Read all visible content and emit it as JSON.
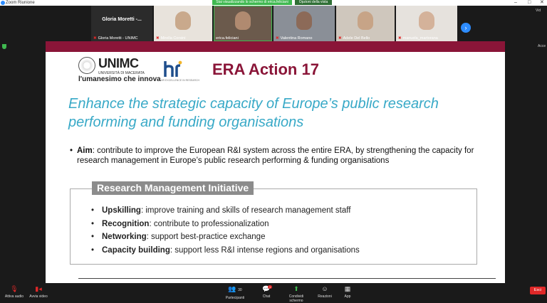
{
  "window": {
    "title": "Zoom Riunione",
    "controls": [
      "–",
      "□",
      "✕"
    ]
  },
  "share_banner": {
    "label": "Stai visualizzando lo schermo di erica.feliciani",
    "view_options": "Opzioni della vista"
  },
  "participants_strip": {
    "big_tile": {
      "display_name": "Gloria Moretti -...",
      "label": "Gloria Moretti - UNIMC"
    },
    "tiles": [
      {
        "label": "Mirella Corsini",
        "face_color": "#c9a98c"
      },
      {
        "label": "erica.feliciani",
        "face_color": "#b08a70"
      },
      {
        "label": "Valentina Romano",
        "face_color": "#8c6a58"
      },
      {
        "label": "Adele Del Bello",
        "face_color": "#c7a487"
      },
      {
        "label": "manuela_martorana",
        "face_color": "#d4b29a"
      }
    ],
    "next_icon": "chevron-right-icon",
    "right_label": "Vid",
    "right_label2": "Acce"
  },
  "slide": {
    "accent_color": "#8a1538",
    "logo": {
      "wordmark": "UNIMC",
      "subtitle": "UNIVERSITÀ DI MACERATA",
      "motto": "l'umanesimo che innova"
    },
    "hr_logo": {
      "mark": "hr",
      "subtitle": "HR EXCELLENCE IN RESEARCH"
    },
    "title": "ERA Action 17",
    "headline": "Enhance the strategic capacity of Europe’s public research performing and funding organisations",
    "aim": {
      "label": "Aim",
      "text": ": contribute to improve the European R&I system across the entire ERA, by strengthening the capacity for research management in Europe’s public research performing & funding organisations"
    },
    "initiative": {
      "heading": "Research Management Initiative",
      "items": [
        {
          "label": "Upskilling",
          "text": ": improve training and skills of research management staff"
        },
        {
          "label": "Recognition",
          "text": ": contribute to professionalization"
        },
        {
          "label": "Networking",
          "text": ": support best-practice exchange"
        },
        {
          "label": "Capacity building",
          "text": ": support less R&I intense regions and organisations"
        }
      ]
    }
  },
  "toolbar": {
    "audio": "Attiva audio",
    "video": "Avvia video",
    "participants": "Partecipanti",
    "participants_count": "30",
    "chat": "Chat",
    "chat_badge": "1",
    "share": "Condividi schermo",
    "reactions": "Reazioni",
    "apps": "App",
    "end": "Esci"
  }
}
